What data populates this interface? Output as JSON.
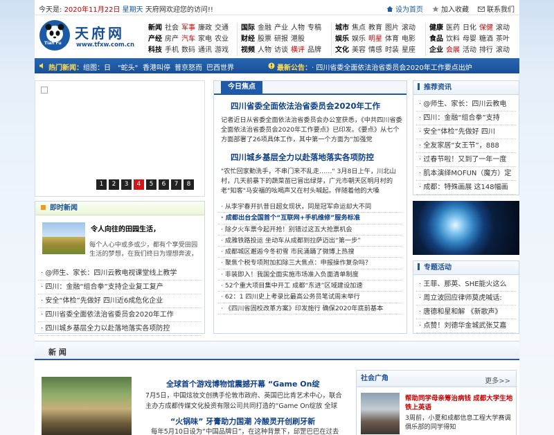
{
  "topbar": {
    "date_prefix": "今天是:",
    "date": "2020年11月22日",
    "weekday": "星期天",
    "welcome": "天府网欢迎您的访问!!",
    "set_home": "设为首页",
    "add_fav": "加入收藏",
    "contact": "联系我们"
  },
  "logo": {
    "name": "天府网",
    "url": "www.tfxw.com.cn",
    "badge": "Tian Fu"
  },
  "nav": {
    "group1": [
      [
        "新闻",
        "社会",
        "军事",
        "廉政",
        "交通"
      ],
      [
        "产经",
        "房产",
        "汽车",
        "家电",
        "农业"
      ],
      [
        "科技",
        "手机",
        "数码",
        "通讯",
        "游戏"
      ]
    ],
    "group2": [
      [
        "国际",
        "金融",
        "产业",
        "人物",
        "专稿"
      ],
      [
        "财经",
        "股票",
        "研报",
        "港股"
      ],
      [
        "视频",
        "人物",
        "访谈",
        "横评",
        "品牌"
      ]
    ],
    "group3": [
      [
        "城市",
        "焦点",
        "教育",
        "图片",
        "滚动"
      ],
      [
        "娱乐",
        "娱乐",
        "明星",
        "体育",
        "电影"
      ],
      [
        "文化",
        "美容",
        "情感",
        "时装",
        "星座"
      ]
    ],
    "group4": [
      [
        "健康",
        "医药",
        "日化",
        "保健",
        "滚动"
      ],
      [
        "食品",
        "饮料",
        "母婴",
        "糖酒",
        "茶叶"
      ],
      [
        "企业",
        "会展",
        "活动",
        "排行",
        "滚动"
      ]
    ]
  },
  "hotbar": {
    "label": "热门新闻：",
    "items": [
      "组图：日",
      "\"蛇头\"",
      "香港叫停",
      "普京怒而",
      "巴西世界"
    ],
    "notice_label": "最新公告：",
    "notice": "· 四川省委全面依法治省委员会2020年工作要点出炉"
  },
  "slider": {
    "pages": [
      "1",
      "2",
      "3",
      "4",
      "5",
      "6",
      "7",
      "8"
    ],
    "active": "4"
  },
  "focus": {
    "tab": "今日焦点",
    "h1": "四川省委全面依法治省委员会2020年工作",
    "p1": "记者近日从省委全面依法治省委员会办公室获悉，《中共四川省委全面依法治省委员会2020年工作要点》已印发。《要点》从七个方面部署了26项具体工作，其中第一个方面为“加强党",
    "h2": "四川城乡基层全力以赴落地落实各项防控",
    "p2": "\"农忙回家勤洗手，不串门来不乱走……\" 3月8日上午，川北山村，几天前暴下的蔬菜苗已冒出绿芽，广元市朝天区明月村的老\"知客\"马安福的吆喝声又在村头喊起。伴随着他的大嗓",
    "list": [
      {
        "t": "· 从李宇春开扒昔日超女现状，同是冠军命运却大不同",
        "b": false
      },
      {
        "t": "· 成都出台全国首个“互联网+手机维修”服务标准",
        "b": true
      },
      {
        "t": "· 除夕火车票今起开抢！别错过这五大抢票机会",
        "b": false
      },
      {
        "t": "· 成雅铁路投运 坐动车从成都到拉萨迈出“第一步”",
        "b": false
      },
      {
        "t": "· 成都城区邂逅今冬初雪 市民涌踊了微博上热搜",
        "b": false
      },
      {
        "t": "· 聚焦个税专项附加扣除三大焦点：申报操作复杂吗？",
        "b": false
      },
      {
        "t": "· 非装即入！我国全面实施市场准入负面清单制度",
        "b": false
      },
      {
        "t": "· 52个重大项目集中开工 成都“东进”区域建设加速",
        "b": false
      },
      {
        "t": "· 62：1 四川史上考录比最高公务员笔试周末举行",
        "b": false
      },
      {
        "t": "· 《四川省固校改革方案》印发施行 确保2020年底前基本",
        "b": false
      }
    ]
  },
  "instant": {
    "title": "即时新闻",
    "lead_title": "令人向往的田园生活，",
    "lead_text": "每个人心中或多或少，都有个享受田园生活的梦想，在我们终日为理想奔波，",
    "list": [
      "· @师生、家长：四川云教电视课堂线上教学",
      "· 四川：金融“组合拳”支持企业复工复产",
      "· 安全“体检”先做好 四川近6成危化企业",
      "· 四川省委全面依法治省委员会2020年工作",
      "· 四川城乡基层全力以赴落地落实各项防控"
    ]
  },
  "recommend": {
    "title": "推荐资讯",
    "list": [
      "· @师生、家长：四川云教电",
      "· 四川：金融“组合拳”支持",
      "· 安全“体检”先做好 四川",
      "· 全友家居“女王节”，888",
      "· 过春节啦！又到了一年一度",
      "· 肌本演绎MOFUN（魔方）定",
      "· 成都：特殊画展 这148幅画"
    ]
  },
  "special": {
    "title": "专题活动",
    "list": [
      "· 王菲、那英、SHE能火这么",
      "· 周立波回应律师莫虎喊话:",
      "· 唐德和星和解 《新歌声》",
      "· 点赞！刘德华金城武张艾嘉"
    ]
  },
  "news": {
    "title": "新  闻",
    "h1": "全球首个游戏博物馆震撼开幕 “Game On绽",
    "p1": "7月5日，中国炫妆文创携手伦敦市政府、英国巴比肯艺术中心，联合主办方成都传媒文化投资有限公司共同打造的“Game On绽放 全球",
    "h2": "“火锅味” 牙膏助力国潮 冷酸灵开创刷牙新",
    "p2": "每年5月10日设为“中国品牌日”，在这种背景下，邱罡巴巴在过去"
  },
  "social": {
    "title": "社会广角",
    "more": "更多>>",
    "h": "帮助同学母亲筹治病钱 成都大学生地铁上英语",
    "p": "3周前，小夏和成都信息工程大学赛调俱乐部的同学得知"
  }
}
